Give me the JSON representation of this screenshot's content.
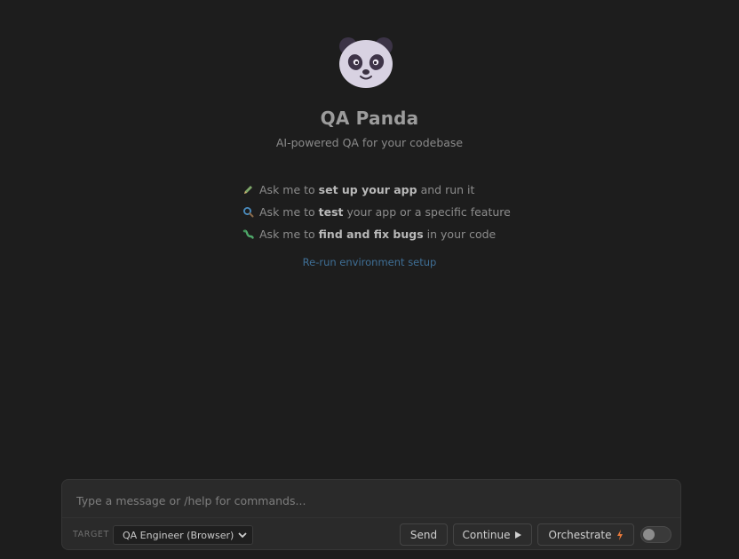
{
  "app": {
    "title": "QA Panda",
    "subtitle": "AI-powered QA for your codebase"
  },
  "tips": [
    {
      "icon": "pencil-icon",
      "prefix": "Ask me to ",
      "bold": "set up your app",
      "suffix": " and run it"
    },
    {
      "icon": "magnifier-icon",
      "prefix": "Ask me to ",
      "bold": "test",
      "suffix": " your app or a specific feature"
    },
    {
      "icon": "bug-icon",
      "prefix": "Ask me to ",
      "bold": "find and fix bugs",
      "suffix": " in your code"
    }
  ],
  "rerun_link": "Re-run environment setup",
  "composer": {
    "placeholder": "Type a message or /help for commands...",
    "target_label": "TARGET",
    "target_value": "QA Engineer (Browser)",
    "send_label": "Send",
    "continue_label": "Continue",
    "orchestrate_label": "Orchestrate",
    "toggle_on": false
  },
  "colors": {
    "background": "#1d1d1d",
    "link": "#3f6f96",
    "bolt": "#e8793a"
  }
}
